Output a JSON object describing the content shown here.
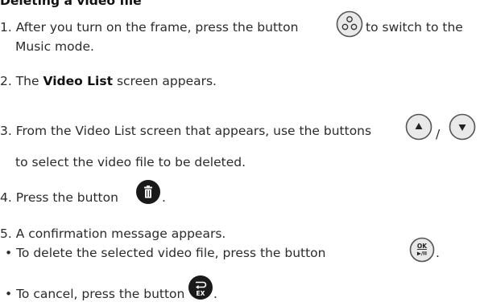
{
  "section_title": "Deleting a video file",
  "steps": {
    "s1": {
      "prefix": "1. After you turn on the frame, press the button",
      "suffix": "to switch to the",
      "line2": "Music mode.",
      "icon": "mode-icon"
    },
    "s2": {
      "prefix": "2. The",
      "bold": "Video List",
      "suffix": "screen appears."
    },
    "s3": {
      "prefix": "3. From the Video List screen that appears, use the buttons",
      "sep": "/",
      "line2": "to select the video file to be deleted.",
      "icons": [
        "up-arrow-icon",
        "down-arrow-icon"
      ]
    },
    "s4": {
      "prefix": "4. Press the button",
      "suffix": ".",
      "icon": "trash-icon"
    },
    "s5": {
      "text": "5. A confirmation message appears.",
      "bullets": [
        {
          "text": "• To delete the selected video file, press the button",
          "suffix": ".",
          "icon": "ok-play-pause-icon",
          "icon_label_top": "OK",
          "icon_label_bottom": "▶/II"
        },
        {
          "text": "• To cancel, press the button",
          "suffix": ".",
          "icon": "back-exit-icon",
          "icon_label": "EX"
        }
      ]
    }
  },
  "colors": {
    "text": "#2b2b2b",
    "button_outline": "#555555",
    "button_fill": "#e9e9e9",
    "dark_button": "#1a1a1a"
  }
}
